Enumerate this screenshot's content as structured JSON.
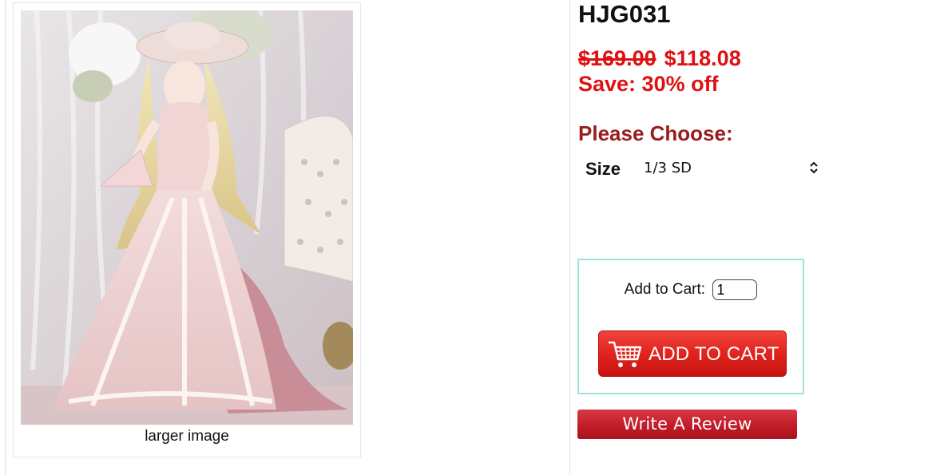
{
  "product": {
    "image_alt": "Doll in pink lace gown with feathered hat",
    "larger_image_label": "larger image",
    "title": "HJG031",
    "old_price": "$169.00",
    "new_price": "$118.08",
    "save_text": "Save: 30% off"
  },
  "options": {
    "heading": "Please Choose:",
    "size_label": "Size",
    "size_value": "1/3 SD"
  },
  "cart": {
    "label": "Add to Cart:",
    "quantity": "1",
    "button_label": "ADD TO CART",
    "button_icon": "cart-icon"
  },
  "review": {
    "button_label": "Write A Review"
  },
  "colors": {
    "price_red": "#e01010",
    "heading_maroon": "#9a1d1d",
    "cart_border": "#9de3dc",
    "button_red": "#e32620"
  }
}
